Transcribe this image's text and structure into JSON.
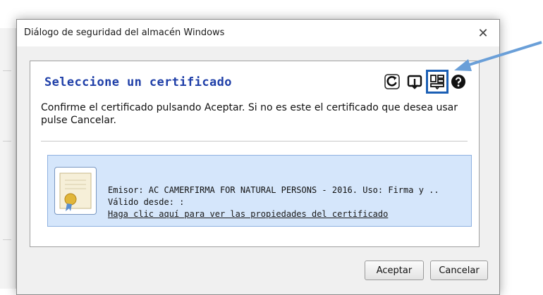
{
  "window": {
    "title": "Diálogo de seguridad del almacén Windows",
    "close_glyph": "✕"
  },
  "panel": {
    "heading": "Seleccione un certificado",
    "description": "Confirme el certificado pulsando Aceptar. Si no es este el certificado que desea usar pulse Cancelar.",
    "toolbar": [
      {
        "icon": "refresh-icon"
      },
      {
        "icon": "import-icon"
      },
      {
        "icon": "view-details-icon",
        "highlighted": true
      },
      {
        "icon": "help-icon"
      }
    ]
  },
  "certificate": {
    "icon": "certificate-icon",
    "issuer_line": "Emisor: AC CAMERFIRMA FOR NATURAL PERSONS - 2016. Uso: Firma y ..",
    "valid_from_line": "Válido desde: :",
    "properties_link": "Haga clic aquí para ver las propiedades del certificado"
  },
  "buttons": {
    "accept_label": "Aceptar",
    "cancel_label": "Cancelar"
  },
  "colors": {
    "heading": "#1f3fa8",
    "card_background": "#d5e6fb",
    "highlight_box": "#1b5fb4",
    "annotation_arrow": "#6a9fd8"
  }
}
